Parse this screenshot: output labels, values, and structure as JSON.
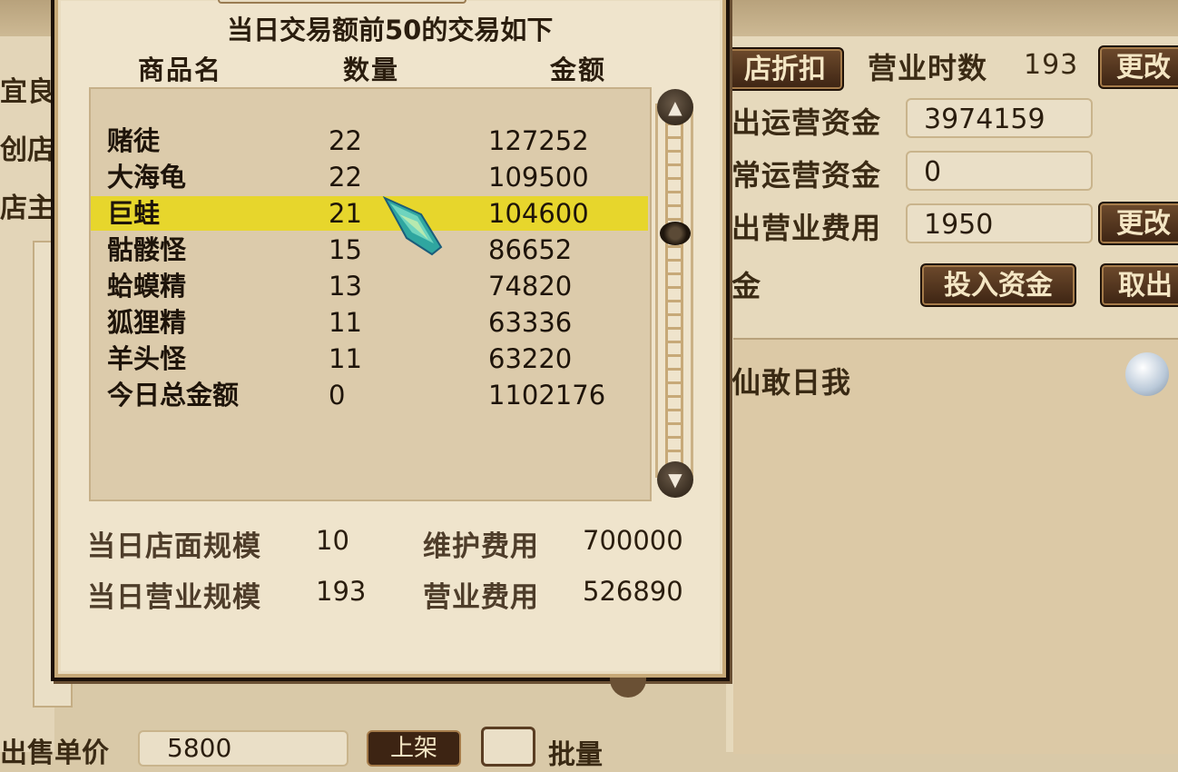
{
  "background": {
    "left_labels": [
      "宜良",
      "创店",
      "店主"
    ],
    "right": {
      "discount_button": "店折扣",
      "business_hours_label": "营业时数",
      "business_hours_value": "193",
      "change_button_1": "更改",
      "operating_funds_label": "出运营资金",
      "operating_funds_value": "3974159",
      "regular_funds_label": "常运营资金",
      "regular_funds_value": "0",
      "business_expense_label": "出营业费用",
      "business_expense_value": "1950",
      "change_button_2": "更改",
      "funds_label": "金",
      "invest_button": "投入资金",
      "withdraw_button": "取出",
      "owner_name": "仙敢日我"
    },
    "bottom": {
      "unit_price_label": "出售单价",
      "unit_price_value": "5800",
      "list_button": "上架",
      "batch_label": "批量"
    }
  },
  "dialog": {
    "title": "当日交易额前50的交易如下",
    "columns": {
      "name": "商品名",
      "quantity": "数量",
      "amount": "金额"
    },
    "rows": [
      {
        "name": "赌徒",
        "quantity": "22",
        "amount": "127252"
      },
      {
        "name": "大海龟",
        "quantity": "22",
        "amount": "109500"
      },
      {
        "name": "巨蛙",
        "quantity": "21",
        "amount": "104600",
        "selected": true
      },
      {
        "name": "骷髅怪",
        "quantity": "15",
        "amount": "86652"
      },
      {
        "name": "蛤蟆精",
        "quantity": "13",
        "amount": "74820"
      },
      {
        "name": "狐狸精",
        "quantity": "11",
        "amount": "63336"
      },
      {
        "name": "羊头怪",
        "quantity": "11",
        "amount": "63220"
      },
      {
        "name": "今日总金额",
        "quantity": "0",
        "amount": "1102176"
      }
    ],
    "stats": {
      "store_scale_label": "当日店面规模",
      "store_scale_value": "10",
      "maintenance_label": "维护费用",
      "maintenance_value": "700000",
      "business_scale_label": "当日营业规模",
      "business_scale_value": "193",
      "business_fee_label": "营业费用",
      "business_fee_value": "526890"
    },
    "scroll_up_icon": "▲",
    "scroll_down_icon": "▼"
  },
  "colors": {
    "selected_row": "#e7d62c",
    "button_bg": "#3d2413",
    "panel_bg": "#efe4cc"
  }
}
